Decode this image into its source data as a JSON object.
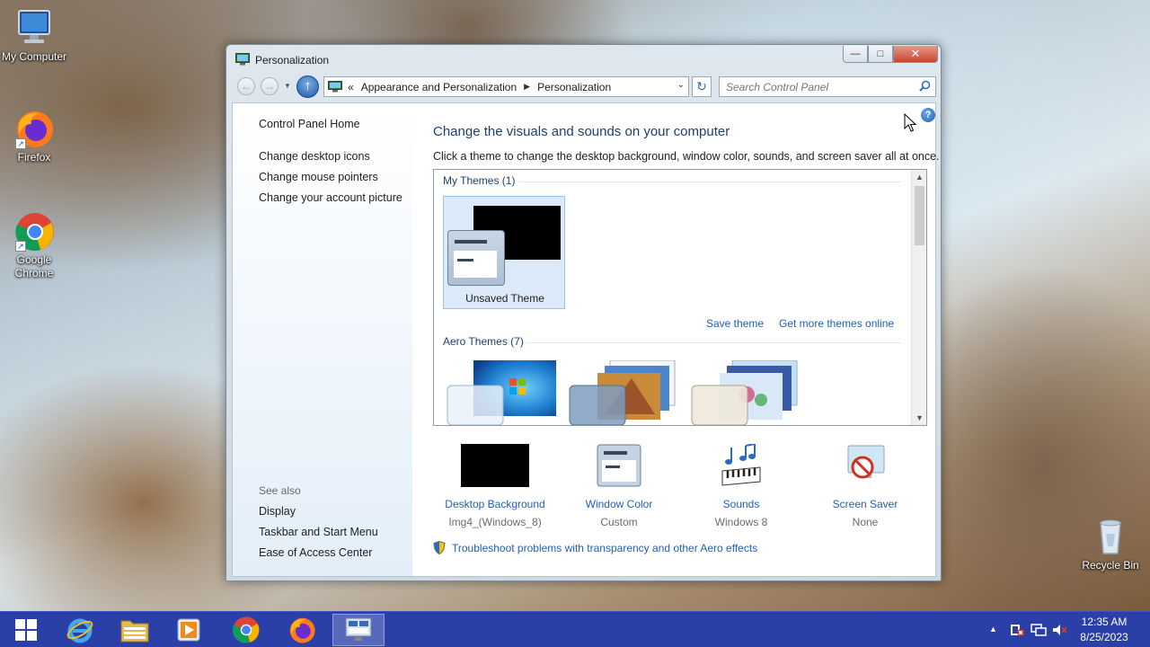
{
  "desktop": {
    "icons": [
      {
        "label": "My Computer"
      },
      {
        "label": "Firefox"
      },
      {
        "label": "Google Chrome"
      },
      {
        "label": "Recycle Bin"
      }
    ]
  },
  "window": {
    "title": "Personalization",
    "controls": {
      "minimize": "—",
      "maximize": "□",
      "close": "✕"
    }
  },
  "address_bar": {
    "overflow": "«",
    "crumbs": [
      "Appearance and Personalization",
      "Personalization"
    ],
    "search_placeholder": "Search Control Panel"
  },
  "left_pane": {
    "links": [
      "Control Panel Home",
      "Change desktop icons",
      "Change mouse pointers",
      "Change your account picture"
    ],
    "see_also_label": "See also",
    "see_also": [
      "Display",
      "Taskbar and Start Menu",
      "Ease of Access Center"
    ]
  },
  "main": {
    "title": "Change the visuals and sounds on your computer",
    "description": "Click a theme to change the desktop background, window color, sounds, and screen saver all at once.",
    "my_themes_label": "My Themes (1)",
    "my_themes": [
      {
        "name": "Unsaved Theme",
        "selected": true
      }
    ],
    "save_theme_link": "Save theme",
    "more_themes_link": "Get more themes online",
    "aero_themes_label": "Aero Themes (7)",
    "settings": [
      {
        "label": "Desktop Background",
        "value": "Img4_(Windows_8)"
      },
      {
        "label": "Window Color",
        "value": "Custom"
      },
      {
        "label": "Sounds",
        "value": "Windows 8"
      },
      {
        "label": "Screen Saver",
        "value": "None"
      }
    ],
    "troubleshoot_link": "Troubleshoot problems with transparency and other Aero effects",
    "help_label": "?"
  },
  "taskbar": {
    "items": [
      "start-button",
      "internet-explorer",
      "file-explorer",
      "media-player",
      "google-chrome",
      "firefox",
      "personalization"
    ],
    "clock": {
      "time": "12:35 AM",
      "date": "8/25/2023"
    },
    "tray_expand": "▲"
  },
  "colors": {
    "link": "#1f5fb6",
    "title": "#1d3f70",
    "taskbar": "#2a3fa8",
    "close_button": "#c9452f"
  }
}
